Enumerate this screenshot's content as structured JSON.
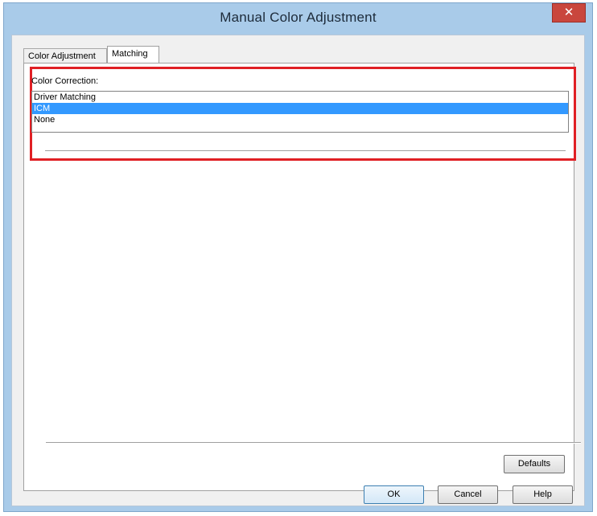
{
  "window": {
    "title": "Manual Color Adjustment",
    "close_label": "✕"
  },
  "tabs": [
    {
      "label": "Color Adjustment"
    },
    {
      "label": "Matching"
    }
  ],
  "matching": {
    "color_correction_label": "Color Correction:",
    "options": [
      {
        "label": "Driver Matching",
        "selected": false
      },
      {
        "label": "ICM",
        "selected": true
      },
      {
        "label": "None",
        "selected": false
      }
    ]
  },
  "buttons": {
    "defaults": "Defaults",
    "ok": "OK",
    "cancel": "Cancel",
    "help": "Help"
  },
  "colors": {
    "highlight_frame": "#e01f24",
    "selection": "#3399ff",
    "title_bar": "#a9cbe9",
    "close_button": "#c9463d"
  }
}
